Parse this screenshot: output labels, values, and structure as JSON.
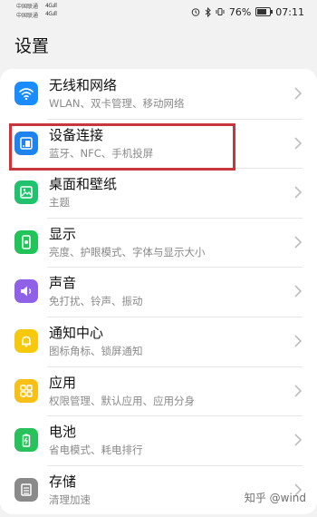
{
  "status_bar": {
    "carrier_1": "中国联通",
    "carrier_2": "中国联通",
    "signal_1": "4G.ıll",
    "signal_2": "4G.ıll",
    "battery_percent": "76%",
    "time": "07:11",
    "battery_level": 0.76,
    "icons": [
      "alarm-icon",
      "bluetooth-icon",
      "vibrate-icon",
      "battery-icon"
    ]
  },
  "page": {
    "title": "设置"
  },
  "items": [
    {
      "title": "无线和网络",
      "subtitle": "WLAN、双卡管理、移动网络",
      "icon": "wifi-icon",
      "color": "#1a8cff"
    },
    {
      "title": "设备连接",
      "subtitle": "蓝牙、NFC、手机投屏",
      "icon": "device-connection-icon",
      "color": "#1e83ef"
    },
    {
      "title": "桌面和壁纸",
      "subtitle": "主题",
      "icon": "wallpaper-icon",
      "color": "#20c26e"
    },
    {
      "title": "显示",
      "subtitle": "亮度、护眼模式、字体与显示大小",
      "icon": "display-icon",
      "color": "#22c45a"
    },
    {
      "title": "声音",
      "subtitle": "免打扰、铃声、振动",
      "icon": "sound-icon",
      "color": "#8f61e6"
    },
    {
      "title": "通知中心",
      "subtitle": "图标角标、锁屏通知",
      "icon": "bell-icon",
      "color": "#f6c90f"
    },
    {
      "title": "应用",
      "subtitle": "权限管理、默认应用、应用分身",
      "icon": "apps-icon",
      "color": "#f8bf16"
    },
    {
      "title": "电池",
      "subtitle": "省电模式、耗电排行",
      "icon": "battery-setting-icon",
      "color": "#28c15b"
    },
    {
      "title": "存储",
      "subtitle": "清理加速",
      "icon": "storage-icon",
      "color": "#8a8a8a"
    }
  ],
  "watermark": "知乎 @wind",
  "highlight_color": "#c8363d"
}
